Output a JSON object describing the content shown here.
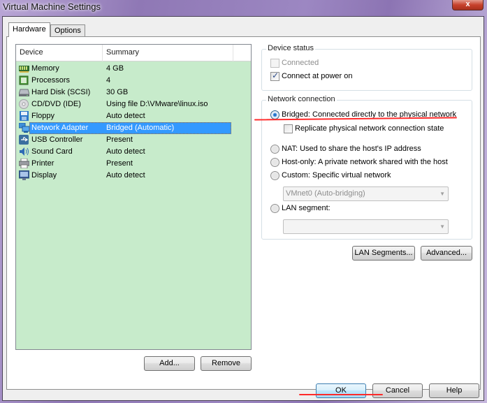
{
  "window": {
    "title": "Virtual Machine Settings",
    "close_icon": "close-x-icon",
    "close_glyph": "x"
  },
  "tabs": [
    {
      "label": "Hardware",
      "active": true
    },
    {
      "label": "Options",
      "active": false
    }
  ],
  "device_list": {
    "columns": [
      "Device",
      "Summary"
    ],
    "rows": [
      {
        "device": "Memory",
        "summary": "4 GB",
        "icon": "memory-icon"
      },
      {
        "device": "Processors",
        "summary": "4",
        "icon": "processor-icon"
      },
      {
        "device": "Hard Disk (SCSI)",
        "summary": "30 GB",
        "icon": "hard-disk-icon"
      },
      {
        "device": "CD/DVD (IDE)",
        "summary": "Using file D:\\VMware\\linux.iso",
        "icon": "cd-dvd-icon"
      },
      {
        "device": "Floppy",
        "summary": "Auto detect",
        "icon": "floppy-icon"
      },
      {
        "device": "Network Adapter",
        "summary": "Bridged (Automatic)",
        "icon": "network-adapter-icon",
        "selected": true
      },
      {
        "device": "USB Controller",
        "summary": "Present",
        "icon": "usb-icon"
      },
      {
        "device": "Sound Card",
        "summary": "Auto detect",
        "icon": "sound-card-icon"
      },
      {
        "device": "Printer",
        "summary": "Present",
        "icon": "printer-icon"
      },
      {
        "device": "Display",
        "summary": "Auto detect",
        "icon": "display-icon"
      }
    ],
    "add_label": "Add...",
    "remove_label": "Remove"
  },
  "device_status": {
    "title": "Device status",
    "connected": {
      "label": "Connected",
      "checked": false,
      "enabled": false
    },
    "connect_at_power_on": {
      "label": "Connect at power on",
      "checked": true,
      "enabled": true
    }
  },
  "network_connection": {
    "title": "Network connection",
    "bridged": {
      "label": "Bridged: Connected directly to the physical network",
      "checked": true
    },
    "replicate": {
      "label": "Replicate physical network connection state",
      "checked": false
    },
    "nat": {
      "label": "NAT: Used to share the host's IP address",
      "checked": false
    },
    "host_only": {
      "label": "Host-only: A private network shared with the host",
      "checked": false
    },
    "custom": {
      "label": "Custom: Specific virtual network",
      "checked": false
    },
    "custom_select_value": "VMnet0 (Auto-bridging)",
    "lan_segment": {
      "label": "LAN segment:",
      "checked": false
    },
    "lan_segment_select_value": "",
    "check_glyph": "✓",
    "dropdown_glyph": "▼"
  },
  "buttons": {
    "lan_segments": "LAN Segments...",
    "advanced": "Advanced...",
    "ok": "OK",
    "cancel": "Cancel",
    "help": "Help"
  },
  "annotations": {
    "highlight_color": "#ff2a2a"
  }
}
